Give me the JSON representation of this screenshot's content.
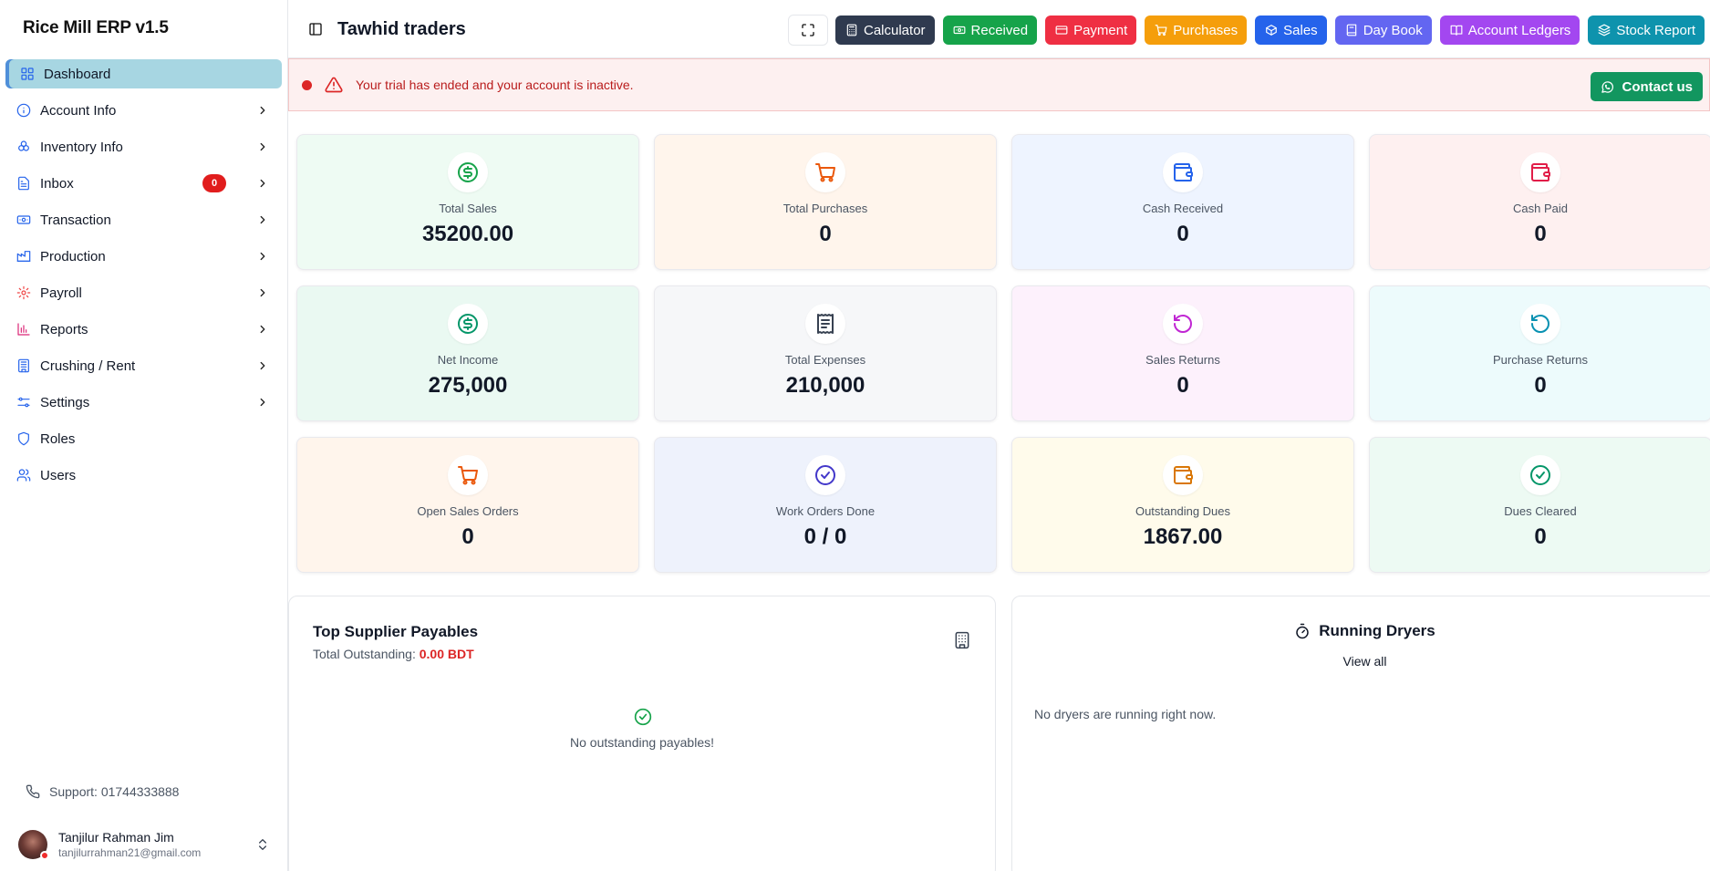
{
  "app": {
    "brand": "Rice Mill ERP v1.5"
  },
  "sidebar": {
    "items": [
      {
        "label": "Dashboard",
        "icon": "grid-icon",
        "active": true,
        "chevron": false
      },
      {
        "label": "Account Info",
        "icon": "info-icon",
        "chevron": true
      },
      {
        "label": "Inventory Info",
        "icon": "boxes-icon",
        "chevron": true
      },
      {
        "label": "Inbox",
        "icon": "document-icon",
        "chevron": true,
        "badge": "0"
      },
      {
        "label": "Transaction",
        "icon": "banknote-icon",
        "chevron": true
      },
      {
        "label": "Production",
        "icon": "factory-icon",
        "chevron": true
      },
      {
        "label": "Payroll",
        "icon": "cog-icon",
        "chevron": true
      },
      {
        "label": "Reports",
        "icon": "bar-chart-icon",
        "chevron": true
      },
      {
        "label": "Crushing / Rent",
        "icon": "building-icon",
        "chevron": true
      },
      {
        "label": "Settings",
        "icon": "sliders-icon",
        "chevron": true
      },
      {
        "label": "Roles",
        "icon": "shield-icon",
        "chevron": false
      },
      {
        "label": "Users",
        "icon": "users-icon",
        "chevron": false
      }
    ],
    "support": "Support: 01744333888",
    "user": {
      "name": "Tanjilur Rahman Jim",
      "email": "tanjilurrahman21@gmail.com"
    }
  },
  "header": {
    "company": "Tawhid traders",
    "buttons": [
      {
        "label": "Calculator",
        "color": "#2f3a4f",
        "icon": "calculator-icon"
      },
      {
        "label": "Received",
        "color": "#16a34a",
        "icon": "banknote-icon"
      },
      {
        "label": "Payment",
        "color": "#ef2f43",
        "icon": "credit-card-icon"
      },
      {
        "label": "Purchases",
        "color": "#f59e0b",
        "icon": "cart-icon"
      },
      {
        "label": "Sales",
        "color": "#2563eb",
        "icon": "package-icon"
      },
      {
        "label": "Day Book",
        "color": "#6366f1",
        "icon": "book-icon"
      },
      {
        "label": "Account Ledgers",
        "color": "#a347f0",
        "icon": "ledger-icon"
      },
      {
        "label": "Stock Report",
        "color": "#0e93ad",
        "icon": "layers-icon"
      }
    ]
  },
  "alert": {
    "message": "Your trial has ended and your account is inactive.",
    "contact_label": "Contact us"
  },
  "stats": [
    {
      "label": "Total Sales",
      "value": "35200.00",
      "bg": "#eefbf3",
      "color": "#16a34a",
      "icon": "dollar-icon"
    },
    {
      "label": "Total Purchases",
      "value": "0",
      "bg": "#fff5ec",
      "color": "#ea580c",
      "icon": "cart-icon"
    },
    {
      "label": "Cash Received",
      "value": "0",
      "bg": "#eef4ff",
      "color": "#2563eb",
      "icon": "wallet-icon"
    },
    {
      "label": "Cash Paid",
      "value": "0",
      "bg": "#fef0f0",
      "color": "#e11d48",
      "icon": "wallet-icon"
    },
    {
      "label": "Net Income",
      "value": "275,000",
      "bg": "#eaf9f2",
      "color": "#059669",
      "icon": "dollar-icon"
    },
    {
      "label": "Total Expenses",
      "value": "210,000",
      "bg": "#f6f7f9",
      "color": "#374151",
      "icon": "receipt-icon"
    },
    {
      "label": "Sales Returns",
      "value": "0",
      "bg": "#fdf1fc",
      "color": "#c026d3",
      "icon": "rotate-ccw-icon"
    },
    {
      "label": "Purchase Returns",
      "value": "0",
      "bg": "#edfbfc",
      "color": "#0891b2",
      "icon": "rotate-ccw-icon"
    },
    {
      "label": "Open Sales Orders",
      "value": "0",
      "bg": "#fff5ec",
      "color": "#ea580c",
      "icon": "cart-icon"
    },
    {
      "label": "Work Orders Done",
      "value": "0 / 0",
      "bg": "#eef2fc",
      "color": "#4338ca",
      "icon": "check-circle-icon"
    },
    {
      "label": "Outstanding Dues",
      "value": "1867.00",
      "bg": "#fffbeb",
      "color": "#d97706",
      "icon": "wallet-icon"
    },
    {
      "label": "Dues Cleared",
      "value": "0",
      "bg": "#edfaf3",
      "color": "#059669",
      "icon": "check-circle-icon"
    }
  ],
  "suppliers": {
    "title": "Top Supplier Payables",
    "sub_label": "Total Outstanding: ",
    "sub_amount": "0.00 BDT",
    "empty": "No outstanding payables!"
  },
  "dryers": {
    "title": "Running Dryers",
    "view_all": "View all",
    "empty": "No dryers are running right now."
  }
}
